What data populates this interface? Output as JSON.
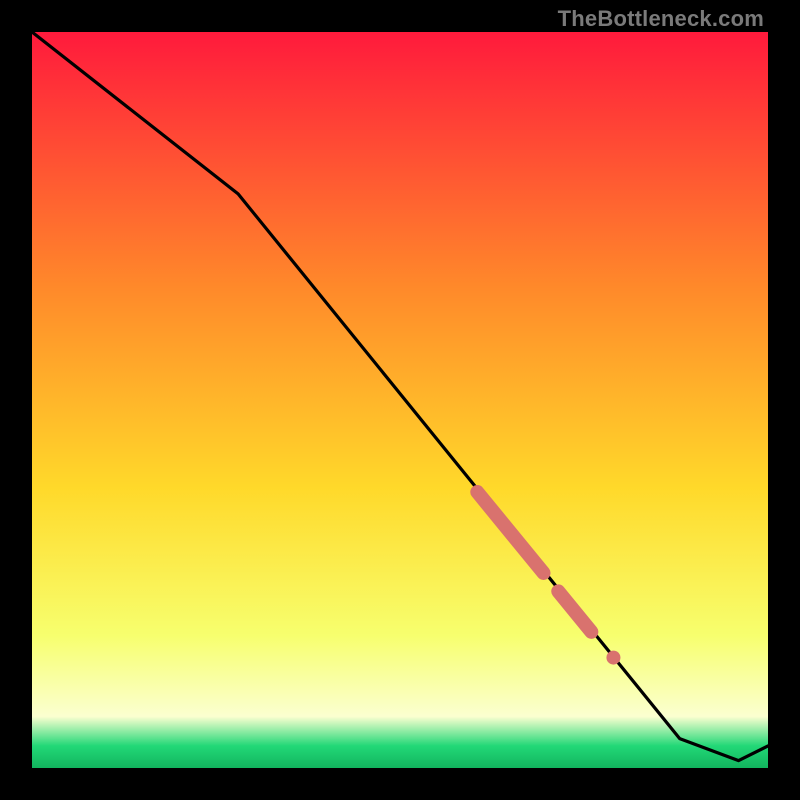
{
  "watermark": "TheBottleneck.com",
  "colors": {
    "top": "#ff1a3c",
    "mid_upper": "#ff8a2a",
    "mid": "#ffd92a",
    "mid_lower": "#f7ff6e",
    "pale": "#fbffd0",
    "green": "#22d877",
    "line": "#000000",
    "marker": "#d9726e"
  },
  "chart_data": {
    "type": "line",
    "title": "",
    "xlabel": "",
    "ylabel": "",
    "xlim": [
      0,
      100
    ],
    "ylim": [
      0,
      100
    ],
    "series": [
      {
        "name": "curve",
        "x": [
          0,
          28,
          88,
          96,
          100
        ],
        "y": [
          100,
          78,
          4,
          1,
          3
        ]
      }
    ],
    "markers": [
      {
        "name": "cluster-main",
        "shape": "thick-segment",
        "x_range": [
          60.5,
          69.5
        ],
        "y_range": [
          37.5,
          26.5
        ]
      },
      {
        "name": "cluster-secondary",
        "shape": "thick-segment",
        "x_range": [
          71.5,
          76.0
        ],
        "y_range": [
          24.0,
          18.5
        ]
      },
      {
        "name": "dot",
        "shape": "dot",
        "x": 79.0,
        "y": 15.0
      }
    ]
  }
}
